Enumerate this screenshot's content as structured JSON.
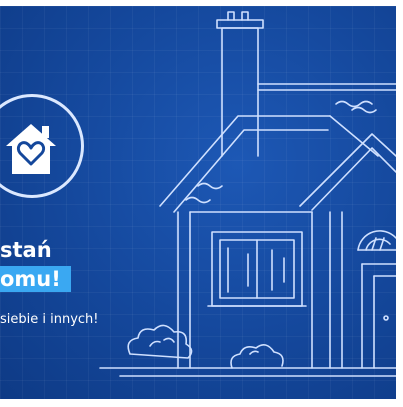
{
  "banner": {
    "headline_line1": "stań",
    "headline_line2": "omu!",
    "subtitle": "siebie i innych!"
  },
  "colors": {
    "background": "#14479b",
    "line": "#cfe0ff",
    "highlight": "#3aa8f2",
    "text": "#ffffff"
  },
  "icons": {
    "logo": "house-heart-icon",
    "illustration": "house-sketch"
  }
}
